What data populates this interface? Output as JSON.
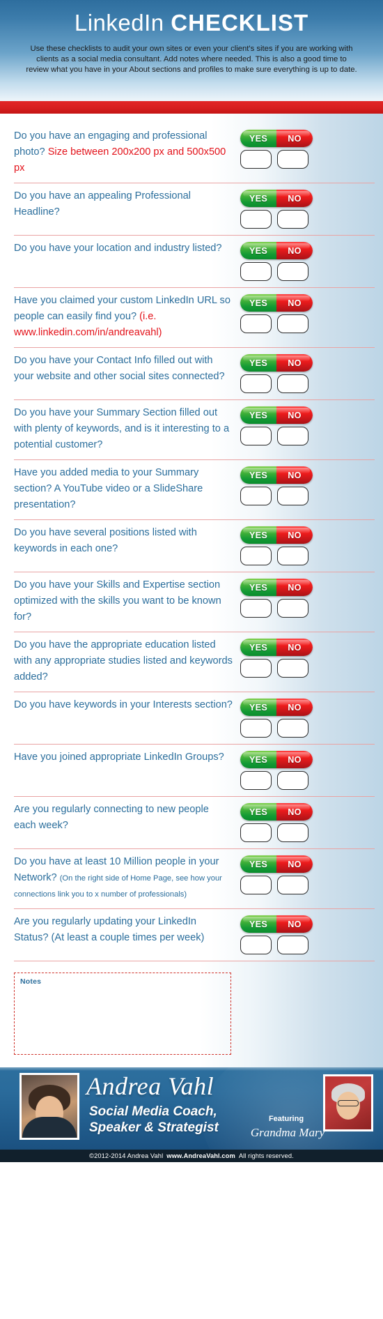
{
  "header": {
    "title_thin": "LinkedIn",
    "title_bold": "CHECKLIST",
    "intro": "Use these checklists to audit your own sites or even your client's sites if you are working with clients as a social media consultant. Add notes where needed. This is also a good time to review what you have in your About sections and profiles to make sure everything is up to date."
  },
  "toggle": {
    "yes_label": "YES",
    "no_label": "NO"
  },
  "items": [
    {
      "text": "Do you have an engaging and professional photo? ",
      "red": "Size between 200x200 px and 500x500 px",
      "small": ""
    },
    {
      "text": "Do you have an appealing Professional Headline?",
      "red": "",
      "small": ""
    },
    {
      "text": "Do you have your location and industry listed?",
      "red": "",
      "small": ""
    },
    {
      "text": "Have you claimed your custom LinkedIn URL so people can easily find you? ",
      "red": "(i.e. www.linkedin.com/in/andreavahl)",
      "small": ""
    },
    {
      "text": "Do you have your Contact Info filled out with your website and other social sites connected?",
      "red": "",
      "small": ""
    },
    {
      "text": "Do you have your Summary Section filled out with plenty of keywords, and is it interesting to a potential customer?",
      "red": "",
      "small": ""
    },
    {
      "text": "Have you added media to your Summary section?  A YouTube video or a SlideShare presentation?",
      "red": "",
      "small": ""
    },
    {
      "text": "Do you have several positions listed with keywords in each one?",
      "red": "",
      "small": ""
    },
    {
      "text": "Do you have your Skills and Expertise section optimized with the skills you want to be known for?",
      "red": "",
      "small": ""
    },
    {
      "text": "Do you have the appropriate education listed with any appropriate studies listed and keywords added?",
      "red": "",
      "small": ""
    },
    {
      "text": "Do you have keywords in your Interests section?",
      "red": "",
      "small": ""
    },
    {
      "text": "Have you joined appropriate LinkedIn Groups?",
      "red": "",
      "small": ""
    },
    {
      "text": "Are you regularly connecting to new people each week?",
      "red": "",
      "small": ""
    },
    {
      "text": "Do you have at least 10 Million people in your Network?  ",
      "red": "",
      "small": "(On the right side of Home Page, see how your connections link you to x number of professionals)"
    },
    {
      "text": "Are you regularly updating your LinkedIn Status?  (At least a couple times per week)",
      "red": "",
      "small": ""
    }
  ],
  "notes": {
    "label": "Notes"
  },
  "footer": {
    "name": "Andrea Vahl",
    "role_line1": "Social Media Coach,",
    "role_line2": "Speaker & Strategist",
    "featuring": "Featuring",
    "grandma": "Grandma Mary"
  },
  "copyright": {
    "left": "©2012-2014  Andrea Vahl",
    "site": "www.AndreaVahl.com",
    "right": "All rights reserved."
  },
  "colors": {
    "brand_blue": "#2b6e9c",
    "accent_red": "#e3121a",
    "yes_green": "#139a34",
    "no_red": "#c6161a",
    "divider": "#e9a3a3",
    "footer_blue": "#215c8c"
  }
}
